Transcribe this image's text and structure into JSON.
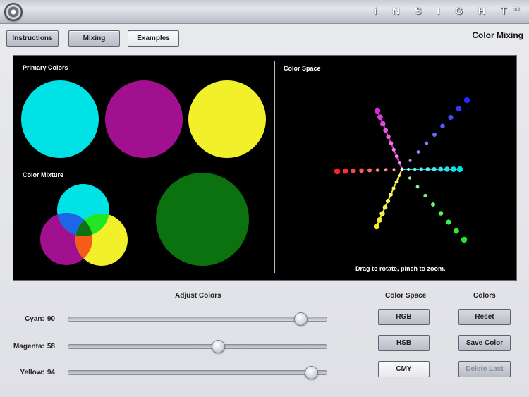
{
  "brand": "i N S I G H T",
  "brand_tm": "TM",
  "nav": {
    "instructions": "Instructions",
    "mixing": "Mixing",
    "examples": "Examples",
    "active": "examples"
  },
  "page_title": "Color Mixing",
  "primary_label": "Primary Colors",
  "mixture_label": "Color Mixture",
  "space_label": "Color Space",
  "space_hint": "Drag to rotate, pinch to zoom.",
  "primaries": {
    "cyan": "#00e2e5",
    "magenta": "#a0108f",
    "yellow": "#f2f02a"
  },
  "result_color": "#0b720f",
  "adjust": {
    "title": "Adjust Colors",
    "sliders": [
      {
        "label": "Cyan:",
        "value": "90",
        "level": 0.9
      },
      {
        "label": "Magenta:",
        "value": "58",
        "level": 0.58
      },
      {
        "label": "Yellow:",
        "value": "94",
        "level": 0.94
      }
    ]
  },
  "color_space": {
    "title": "Color Space",
    "rgb": "RGB",
    "hsb": "HSB",
    "cmy": "CMY",
    "selected": "CMY"
  },
  "colors": {
    "title": "Colors",
    "reset": "Reset",
    "save": "Save Color",
    "delete": "Delete Last"
  }
}
